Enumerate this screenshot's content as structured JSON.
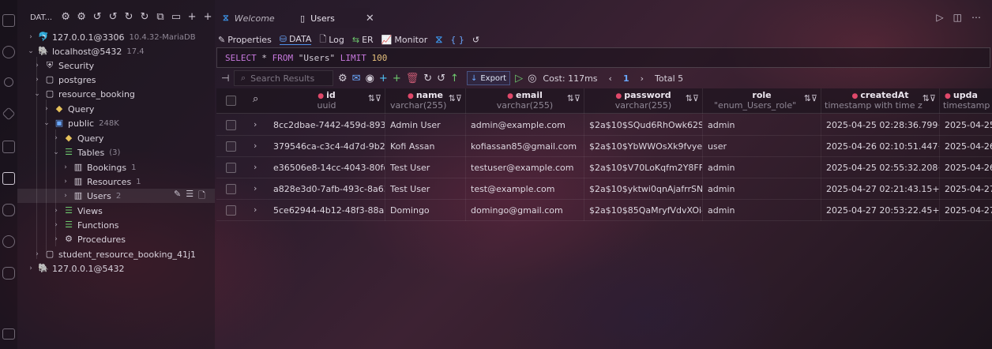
{
  "sidebar": {
    "toolbar_title": "DAT...",
    "tree": [
      {
        "label": "127.0.0.1@3306",
        "meta": "10.4.32-MariaDB"
      },
      {
        "label": "localhost@5432",
        "meta": "17.4"
      },
      {
        "label": "Security",
        "meta": ""
      },
      {
        "label": "postgres",
        "meta": ""
      },
      {
        "label": "resource_booking",
        "meta": ""
      },
      {
        "label": "Query",
        "meta": ""
      },
      {
        "label": "public",
        "meta": "248K"
      },
      {
        "label": "Query",
        "meta": ""
      },
      {
        "label": "Tables",
        "meta": "(3)"
      },
      {
        "label": "Bookings",
        "meta": "1"
      },
      {
        "label": "Resources",
        "meta": "1"
      },
      {
        "label": "Users",
        "meta": "2"
      },
      {
        "label": "Views",
        "meta": ""
      },
      {
        "label": "Functions",
        "meta": ""
      },
      {
        "label": "Procedures",
        "meta": ""
      },
      {
        "label": "student_resource_booking_41j1",
        "meta": ""
      },
      {
        "label": "127.0.0.1@5432",
        "meta": ""
      }
    ]
  },
  "tabs": [
    {
      "label": "Welcome"
    },
    {
      "label": "Users"
    }
  ],
  "subtabs": {
    "properties": "Properties",
    "data": "DATA",
    "log": "Log",
    "er": "ER",
    "monitor": "Monitor",
    "braces": "{ }"
  },
  "sql": {
    "select": "SELECT",
    "star": "*",
    "from": "FROM",
    "table": "\"Users\"",
    "limit": "LIMIT",
    "limit_value": "100"
  },
  "grid_toolbar": {
    "search_placeholder": "Search Results",
    "export_label": "Export",
    "cost": "Cost: 117ms",
    "page": "1",
    "total": "Total 5"
  },
  "columns": [
    {
      "name": "id",
      "type": "uuid"
    },
    {
      "name": "name",
      "type": "varchar(255)"
    },
    {
      "name": "email",
      "type": "varchar(255)"
    },
    {
      "name": "password",
      "type": "varchar(255)"
    },
    {
      "name": "role",
      "type": "\"enum_Users_role\""
    },
    {
      "name": "createdAt",
      "type": "timestamp with time z"
    },
    {
      "name": "upda",
      "type": "timestamp w"
    }
  ],
  "rows": [
    [
      "8cc2dbae-7442-459d-893f-",
      "Admin User",
      "admin@example.com",
      "$2a$10$SQud6RhOwk62SjI",
      "admin",
      "2025-04-25 02:28:36.799+0",
      "2025-04-25"
    ],
    [
      "379546ca-c3c4-4d7d-9b27-",
      "Kofi Assan",
      "kofiassan85@gmail.com",
      "$2a$10$YbWWOsXk9fvyeFS",
      "user",
      "2025-04-26 02:10:51.447+0",
      "2025-04-26"
    ],
    [
      "e36506e8-14cc-4043-80fc-7",
      "Test User",
      "testuser@example.com",
      "$2a$10$V70LoKqfm2Y8FF5",
      "admin",
      "2025-04-25 02:55:32.208+0",
      "2025-04-26"
    ],
    [
      "a828e3d0-7afb-493c-8a63-",
      "Test User",
      "test@example.com",
      "$2a$10$yktwi0qnAjafrrSNk",
      "admin",
      "2025-04-27 02:21:43.15+00",
      "2025-04-27"
    ],
    [
      "5ce62944-4b12-48f3-88a9-",
      "Domingo",
      "domingo@gmail.com",
      "$2a$10$85QaMryfVdvXOi4.",
      "admin",
      "2025-04-27 20:53:22.45+00",
      "2025-04-27"
    ]
  ]
}
